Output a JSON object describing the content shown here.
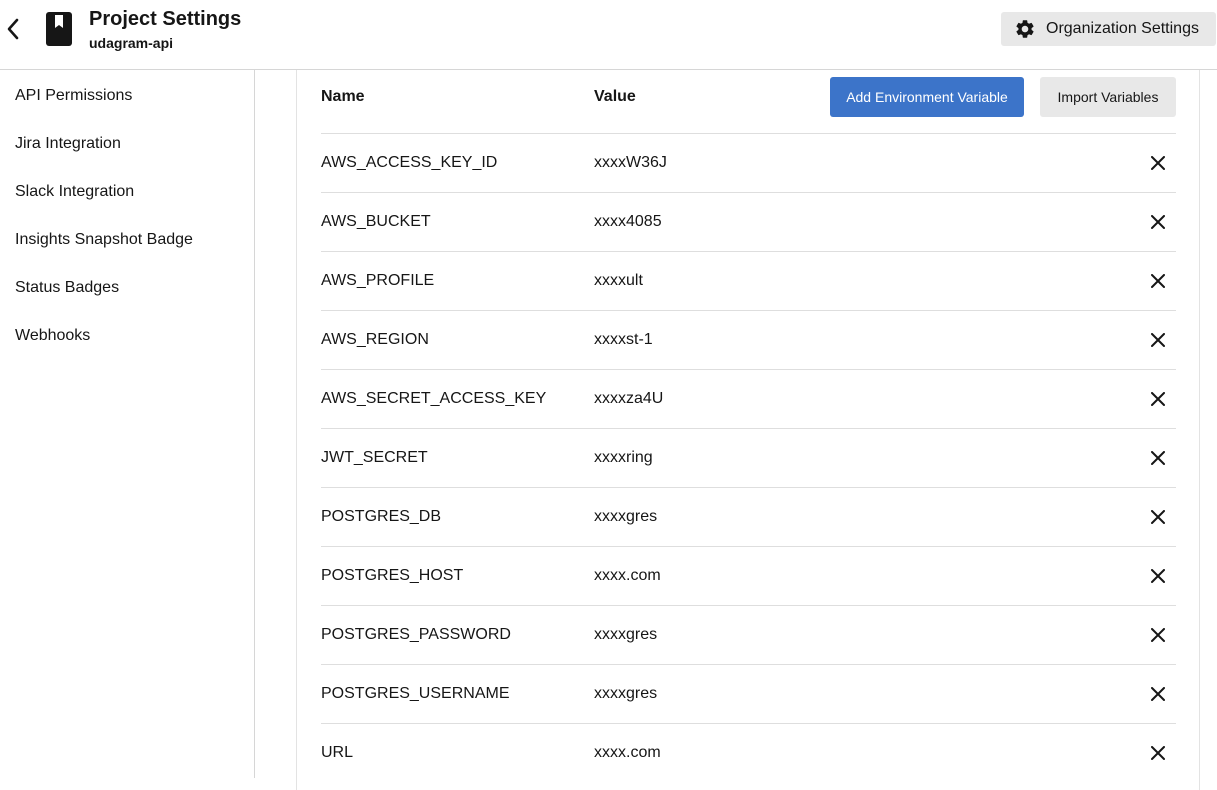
{
  "header": {
    "title": "Project Settings",
    "project_name": "udagram-api",
    "org_settings_label": "Organization Settings",
    "back_icon": "chevron-left-icon",
    "project_icon": "bookmark-icon",
    "org_icon": "gear-icon"
  },
  "sidebar": {
    "items": [
      {
        "label": "API Permissions"
      },
      {
        "label": "Jira Integration"
      },
      {
        "label": "Slack Integration"
      },
      {
        "label": "Insights Snapshot Badge"
      },
      {
        "label": "Status Badges"
      },
      {
        "label": "Webhooks"
      }
    ]
  },
  "env": {
    "col_name": "Name",
    "col_value": "Value",
    "add_label": "Add Environment Variable",
    "import_label": "Import Variables",
    "delete_icon": "close-icon",
    "rows": [
      {
        "name": "AWS_ACCESS_KEY_ID",
        "value": "xxxxW36J"
      },
      {
        "name": "AWS_BUCKET",
        "value": "xxxx4085"
      },
      {
        "name": "AWS_PROFILE",
        "value": "xxxxult"
      },
      {
        "name": "AWS_REGION",
        "value": "xxxxst-1"
      },
      {
        "name": "AWS_SECRET_ACCESS_KEY",
        "value": "xxxxza4U"
      },
      {
        "name": "JWT_SECRET",
        "value": "xxxxring"
      },
      {
        "name": "POSTGRES_DB",
        "value": "xxxxgres"
      },
      {
        "name": "POSTGRES_HOST",
        "value": "xxxx.com"
      },
      {
        "name": "POSTGRES_PASSWORD",
        "value": "xxxxgres"
      },
      {
        "name": "POSTGRES_USERNAME",
        "value": "xxxxgres"
      },
      {
        "name": "URL",
        "value": "xxxx.com"
      }
    ]
  },
  "colors": {
    "primary_button": "#3c74c9",
    "secondary_button": "#e8e8e8",
    "text": "#161616",
    "divider": "#dedede"
  }
}
